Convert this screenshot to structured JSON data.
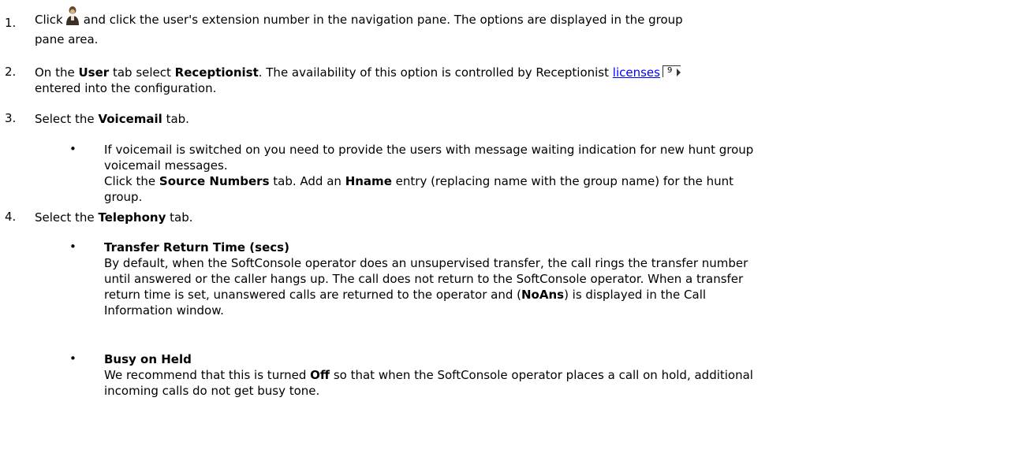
{
  "step1": {
    "num": "1.",
    "t1": "Click",
    "t2": "and click the user's extension number in the navigation pane. The options are displayed in the group",
    "t3": "pane area.",
    "icon": "user-icon"
  },
  "step2": {
    "num": "2.",
    "t1": "On the",
    "b1": "User",
    "t2": "tab select",
    "b2": "Receptionist",
    "t3": ". The availability of this option is controlled by Receptionist",
    "link": "licenses",
    "page": "9",
    "t4": "entered into the configuration."
  },
  "step3": {
    "num": "3.",
    "t1": "Select the",
    "b1": "Voicemail",
    "t2": "tab.",
    "bullet": "•",
    "s1": "If voicemail is switched on you need to provide the users with message waiting indication for new hunt group",
    "s2": "voicemail messages.",
    "s3a": "Click the",
    "s3b": "Source Numbers",
    "s3c": "tab. Add an",
    "s3d": "Hname",
    "s3e": "entry (replacing name with the group name) for the hunt",
    "s4": "group."
  },
  "step4": {
    "num": "4.",
    "t1": "Select the",
    "b1": "Telephony",
    "t2": "tab.",
    "bullet": "•",
    "a_title": "Transfer Return Time (secs)",
    "a1": "By default, when the SoftConsole operator does an unsupervised transfer, the call rings the transfer number",
    "a2": "until answered or the caller hangs up. The call does not return to the SoftConsole operator. When a transfer",
    "a3": "return time is set, unanswered calls are returned to the operator and (",
    "a3b": "NoAns",
    "a3c": ") is displayed in the Call",
    "a4": "Information window.",
    "b_title": "Busy on Held",
    "b1text": "We recommend that this is turned",
    "b1b": "Off",
    "b1c": "so that when the SoftConsole operator places a call on hold, additional",
    "b2": "incoming calls do not get busy tone."
  }
}
